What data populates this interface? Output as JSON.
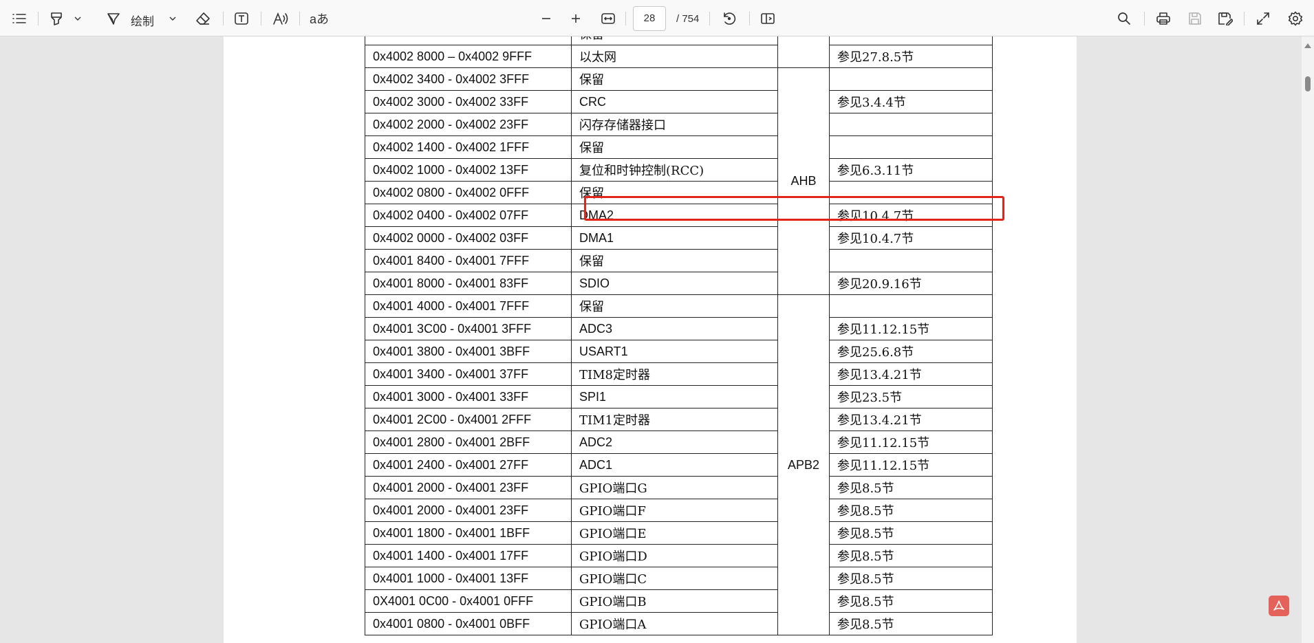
{
  "toolbar": {
    "draw_label": "绘制",
    "current_page": "28",
    "total_pages": "/ 754"
  },
  "icons": {
    "contents": "list-icon",
    "highlight": "highlighter-icon",
    "draw": "pen-icon",
    "erase": "eraser-icon",
    "textbox": "text-box-icon",
    "read_aloud": "read-aloud-icon",
    "translate": "translate-icon",
    "zoom_out": "minus-icon",
    "zoom_in": "plus-icon",
    "fit": "fit-width-icon",
    "rotate": "rotate-icon",
    "page_view": "page-view-icon",
    "search": "search-icon",
    "print": "print-icon",
    "save": "save-icon",
    "save_as": "save-as-icon",
    "fullscreen": "expand-icon",
    "settings": "gear-icon",
    "pdf_badge": "acrobat-icon"
  },
  "colors": {
    "highlight_box": "#e1251b"
  },
  "table": {
    "top_partial": {
      "address": "",
      "peripheral": "保留"
    },
    "rows_above_ahb": [
      {
        "address": "0x4002 8000 – 0x4002 9FFF",
        "peripheral": "以太网",
        "ref": "参见27.8.5节"
      }
    ],
    "ahb_bus": "AHB",
    "ahb_rows": [
      {
        "address": "0x4002 3400 - 0x4002 3FFF",
        "peripheral": "保留",
        "ref": ""
      },
      {
        "address": "0x4002 3000 - 0x4002 33FF",
        "peripheral": "CRC",
        "ref": "参见3.4.4节"
      },
      {
        "address": "0x4002 2000 - 0x4002 23FF",
        "peripheral": "闪存存储器接口",
        "ref": ""
      },
      {
        "address": "0x4002 1400 - 0x4002 1FFF",
        "peripheral": "保留",
        "ref": ""
      },
      {
        "address": "0x4002 1000 - 0x4002 13FF",
        "peripheral": "复位和时钟控制(RCC)",
        "ref": "参见6.3.11节"
      },
      {
        "address": "0x4002 0800 - 0x4002 0FFF",
        "peripheral": "保留",
        "ref": ""
      },
      {
        "address": "0x4002 0400 - 0x4002 07FF",
        "peripheral": "DMA2",
        "ref": "参见10.4.7节"
      },
      {
        "address": "0x4002 0000 - 0x4002 03FF",
        "peripheral": "DMA1",
        "ref": "参见10.4.7节"
      },
      {
        "address": "0x4001 8400 - 0x4001 7FFF",
        "peripheral": "保留",
        "ref": ""
      },
      {
        "address": "0x4001 8000 - 0x4001 83FF",
        "peripheral": "SDIO",
        "ref": "参见20.9.16节"
      }
    ],
    "apb2_bus": "APB2",
    "apb2_rows": [
      {
        "address": "0x4001 4000 - 0x4001 7FFF",
        "peripheral": "保留",
        "ref": ""
      },
      {
        "address": "0x4001 3C00 - 0x4001 3FFF",
        "peripheral": "ADC3",
        "ref": "参见11.12.15节"
      },
      {
        "address": "0x4001 3800 - 0x4001 3BFF",
        "peripheral": "USART1",
        "ref": "参见25.6.8节"
      },
      {
        "address": "0x4001 3400 - 0x4001 37FF",
        "peripheral": "TIM8定时器",
        "ref": "参见13.4.21节"
      },
      {
        "address": "0x4001 3000 - 0x4001 33FF",
        "peripheral": "SPI1",
        "ref": "参见23.5节"
      },
      {
        "address": "0x4001 2C00 - 0x4001 2FFF",
        "peripheral": "TIM1定时器",
        "ref": "参见13.4.21节"
      },
      {
        "address": "0x4001 2800 - 0x4001 2BFF",
        "peripheral": "ADC2",
        "ref": "参见11.12.15节"
      },
      {
        "address": "0x4001 2400 - 0x4001 27FF",
        "peripheral": "ADC1",
        "ref": "参见11.12.15节"
      },
      {
        "address": "0x4001 2000 - 0x4001 23FF",
        "peripheral": "GPIO端口G",
        "ref": "参见8.5节"
      },
      {
        "address": "0x4001 2000 - 0x4001 23FF",
        "peripheral": "GPIO端口F",
        "ref": "参见8.5节"
      },
      {
        "address": "0x4001 1800 - 0x4001 1BFF",
        "peripheral": "GPIO端口E",
        "ref": "参见8.5节"
      },
      {
        "address": "0x4001 1400 - 0x4001 17FF",
        "peripheral": "GPIO端口D",
        "ref": "参见8.5节"
      },
      {
        "address": "0x4001 1000 - 0x4001 13FF",
        "peripheral": "GPIO端口C",
        "ref": "参见8.5节"
      },
      {
        "address": "0X4001 0C00 - 0x4001 0FFF",
        "peripheral": "GPIO端口B",
        "ref": "参见8.5节"
      },
      {
        "address": "0x4001 0800 - 0x4001 0BFF",
        "peripheral": "GPIO端口A",
        "ref": "参见8.5节"
      }
    ]
  }
}
